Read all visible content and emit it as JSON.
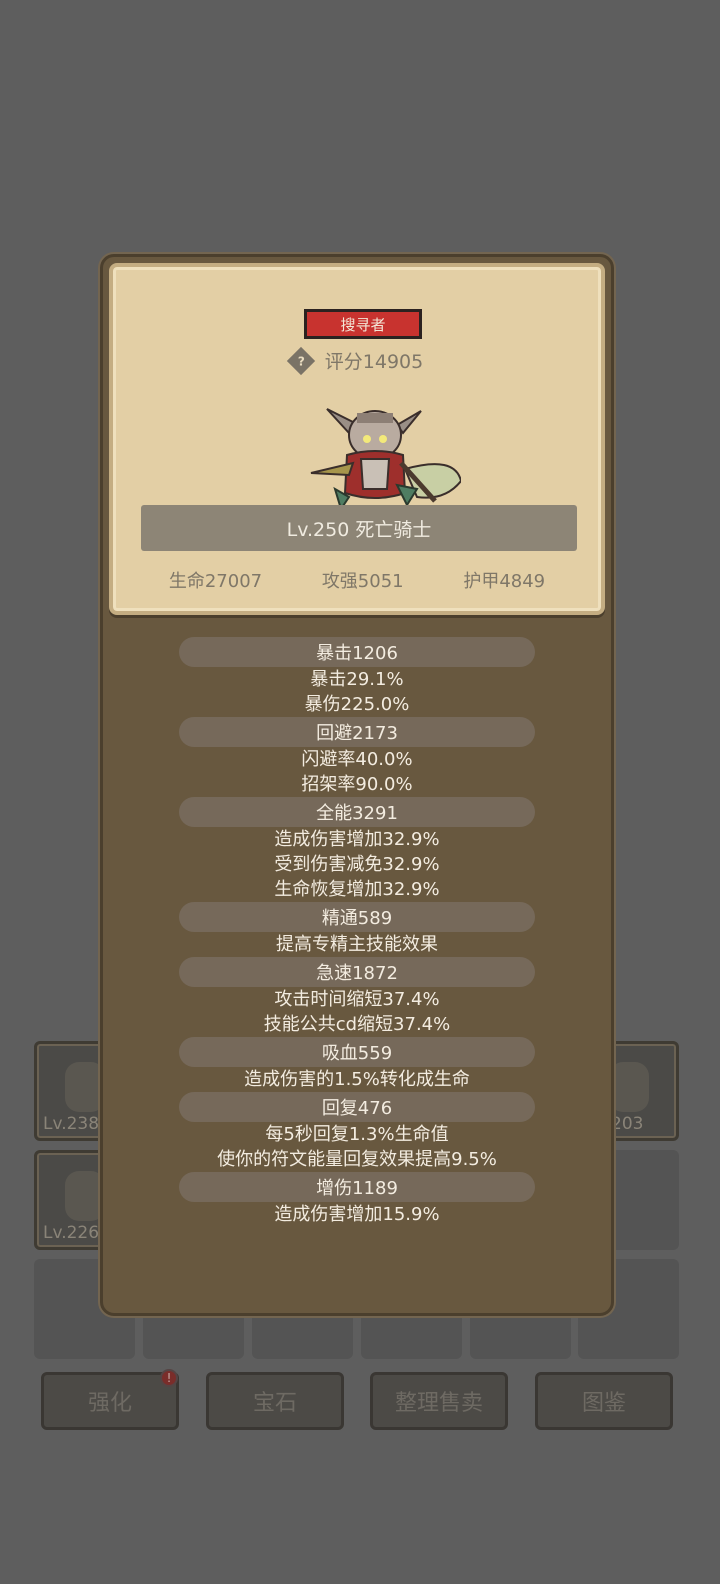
{
  "background": {
    "inventory_items": [
      {
        "level_label": "Lv.238"
      },
      {
        "level_label": "203"
      },
      {
        "level_label": "Lv.226"
      }
    ],
    "buttons": [
      {
        "label": "强化",
        "alert": "!"
      },
      {
        "label": "宝石"
      },
      {
        "label": "整理售卖"
      },
      {
        "label": "图鉴"
      }
    ]
  },
  "item": {
    "rarity": "搜寻者",
    "score": "评分14905",
    "help_glyph": "?",
    "name": "Lv.250 死亡骑士",
    "base_stats": [
      "生命27007",
      "攻强5051",
      "护甲4849"
    ]
  },
  "stats": [
    {
      "head": "暴击1206",
      "lines": [
        "暴击29.1%",
        "暴伤225.0%"
      ]
    },
    {
      "head": "回避2173",
      "lines": [
        "闪避率40.0%",
        "招架率90.0%"
      ]
    },
    {
      "head": "全能3291",
      "lines": [
        "造成伤害增加32.9%",
        "受到伤害减免32.9%",
        "生命恢复增加32.9%"
      ]
    },
    {
      "head": "精通589",
      "lines": [
        "提高专精主技能效果"
      ]
    },
    {
      "head": "急速1872",
      "lines": [
        "攻击时间缩短37.4%",
        "技能公共cd缩短37.4%"
      ]
    },
    {
      "head": "吸血559",
      "lines": [
        "造成伤害的1.5%转化成生命"
      ]
    },
    {
      "head": "回复476",
      "lines": [
        "每5秒回复1.3%生命值",
        "使你的符文能量回复效果提高9.5%"
      ]
    },
    {
      "head": "增伤1189",
      "lines": [
        "造成伤害增加15.9%"
      ]
    }
  ]
}
